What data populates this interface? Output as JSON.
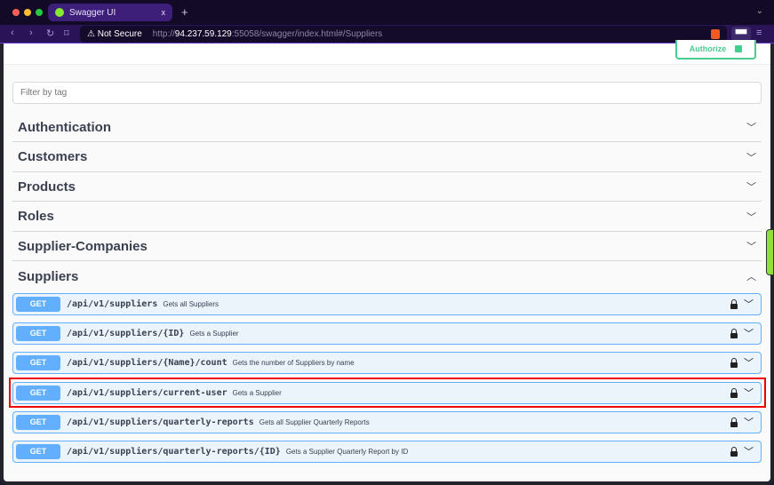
{
  "browser": {
    "tab_title": "Swagger UI",
    "tab_close": "x",
    "new_tab": "+",
    "security": "Not Secure",
    "url_prefix": "http://",
    "url_host": "94.237.59.129",
    "url_rest": ":55058/swagger/index.html#/Suppliers"
  },
  "authorize_label": "Authorize",
  "filter_placeholder": "Filter by tag",
  "sections": [
    {
      "name": "Authentication",
      "chev": "﹀"
    },
    {
      "name": "Customers",
      "chev": "﹀"
    },
    {
      "name": "Products",
      "chev": "﹀"
    },
    {
      "name": "Roles",
      "chev": "﹀"
    },
    {
      "name": "Supplier-Companies",
      "chev": "﹀"
    },
    {
      "name": "Suppliers",
      "chev": "︿"
    }
  ],
  "operations": [
    {
      "method": "GET",
      "path": "/api/v1/suppliers",
      "desc": "Gets all Suppliers"
    },
    {
      "method": "GET",
      "path": "/api/v1/suppliers/{ID}",
      "desc": "Gets a Supplier"
    },
    {
      "method": "GET",
      "path": "/api/v1/suppliers/{Name}/count",
      "desc": "Gets the number of Suppliers by name"
    },
    {
      "method": "GET",
      "path": "/api/v1/suppliers/current-user",
      "desc": "Gets a Supplier"
    },
    {
      "method": "GET",
      "path": "/api/v1/suppliers/quarterly-reports",
      "desc": "Gets all Supplier Quarterly Reports"
    },
    {
      "method": "GET",
      "path": "/api/v1/suppliers/quarterly-reports/{ID}",
      "desc": "Gets a Supplier Quarterly Report by ID"
    }
  ]
}
